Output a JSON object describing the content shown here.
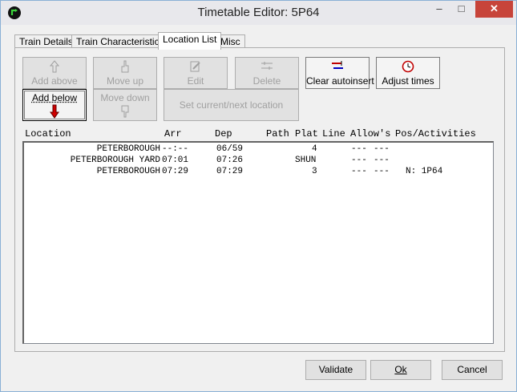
{
  "window": {
    "title": "Timetable Editor: 5P64"
  },
  "titlebar_buttons": {
    "minimize": "–",
    "maximize": "□",
    "close": "✕"
  },
  "tabs": [
    {
      "label": "Train Details"
    },
    {
      "label": "Train Characteristics"
    },
    {
      "label": "Location List"
    },
    {
      "label": "Misc"
    }
  ],
  "toolbar": {
    "add_above": "Add above",
    "move_up": "Move up",
    "edit": "Edit",
    "delete": "Delete",
    "clear_autoinsert": "Clear autoinsert",
    "adjust_times": "Adjust times",
    "add_below": "Add below",
    "move_down": "Move down",
    "set_current_next": "Set current/next location"
  },
  "columns": {
    "location": "Location",
    "arr": "Arr",
    "dep": "Dep",
    "path": "Path",
    "plat": "Plat",
    "line": "Line",
    "allows": "Allow's",
    "pos_activities": "Pos/Activities"
  },
  "rows": [
    {
      "location": "PETERBOROUGH",
      "arr": "--:--",
      "dep": "06/59",
      "path": "",
      "plat": "4",
      "line": "",
      "allow1": "---",
      "allow2": "---",
      "pos": ""
    },
    {
      "location": "PETERBOROUGH YARD",
      "arr": "07:01",
      "dep": "07:26",
      "path": "",
      "plat": "SHUN",
      "line": "",
      "allow1": "---",
      "allow2": "---",
      "pos": ""
    },
    {
      "location": "PETERBOROUGH",
      "arr": "07:29",
      "dep": "07:29",
      "path": "",
      "plat": "3",
      "line": "",
      "allow1": "---",
      "allow2": "---",
      "pos": "N: 1P64"
    }
  ],
  "footer": {
    "validate": "Validate",
    "ok": "Ok",
    "cancel": "Cancel"
  },
  "colors": {
    "accent": "#3c7fb1",
    "close": "#c7443a"
  }
}
